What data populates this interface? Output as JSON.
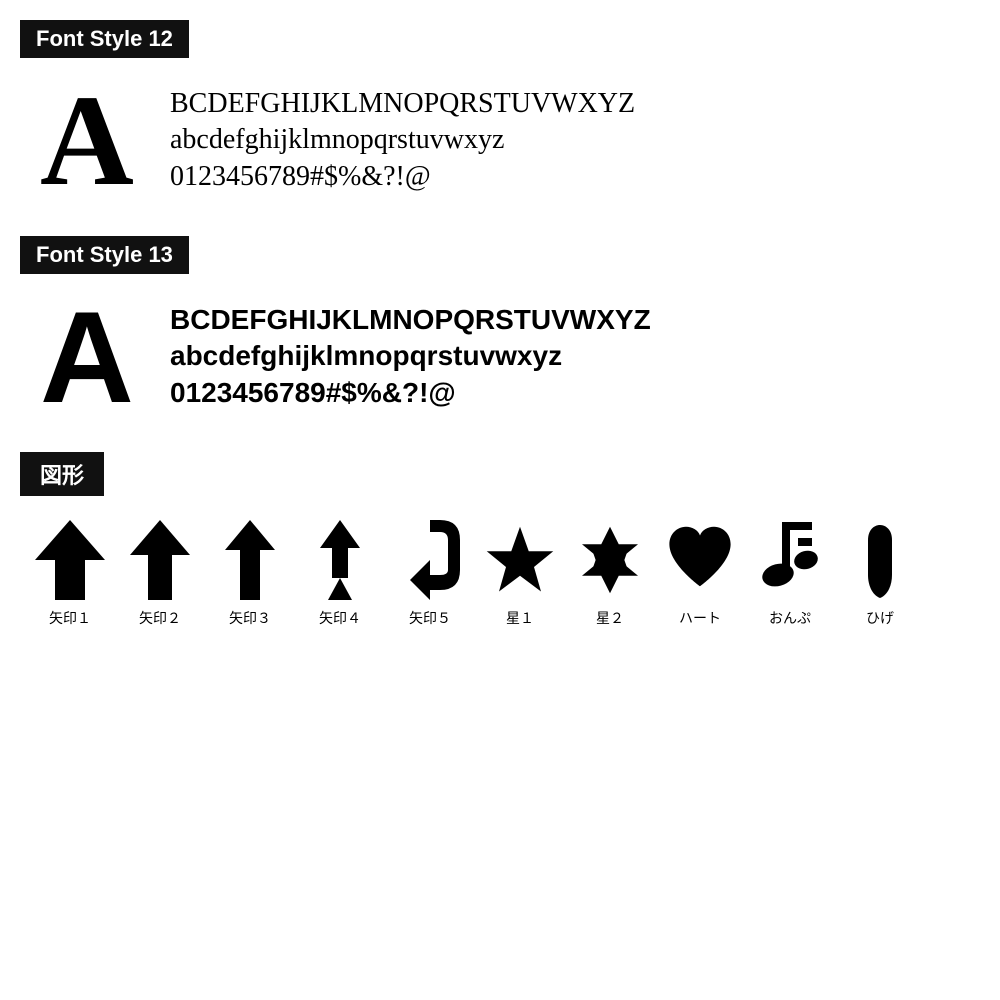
{
  "font_style_12": {
    "header": "Font Style 12",
    "big_letter": "A",
    "line1": "BCDEFGHIJKLMNOPQRSTUVWXYZ",
    "line2": "abcdefghijklmnopqrstuvwxyz",
    "line3": "0123456789#$%&?!@"
  },
  "font_style_13": {
    "header": "Font Style 13",
    "big_letter": "A",
    "line1": "BCDEFGHIJKLMNOPQRSTUVWXYZ",
    "line2": "abcdefghijklmnopqrstuvwxyz",
    "line3": "0123456789#$%&?!@"
  },
  "shapes": {
    "header": "図形",
    "items": [
      {
        "label": "矢印１",
        "type": "arrow1"
      },
      {
        "label": "矢印２",
        "type": "arrow2"
      },
      {
        "label": "矢印３",
        "type": "arrow3"
      },
      {
        "label": "矢印４",
        "type": "arrow4"
      },
      {
        "label": "矢印５",
        "type": "arrow5"
      },
      {
        "label": "星１",
        "type": "star1"
      },
      {
        "label": "星２",
        "type": "star2"
      },
      {
        "label": "ハート",
        "type": "heart"
      },
      {
        "label": "おんぷ",
        "type": "note"
      },
      {
        "label": "ひげ",
        "type": "mustache"
      }
    ]
  }
}
